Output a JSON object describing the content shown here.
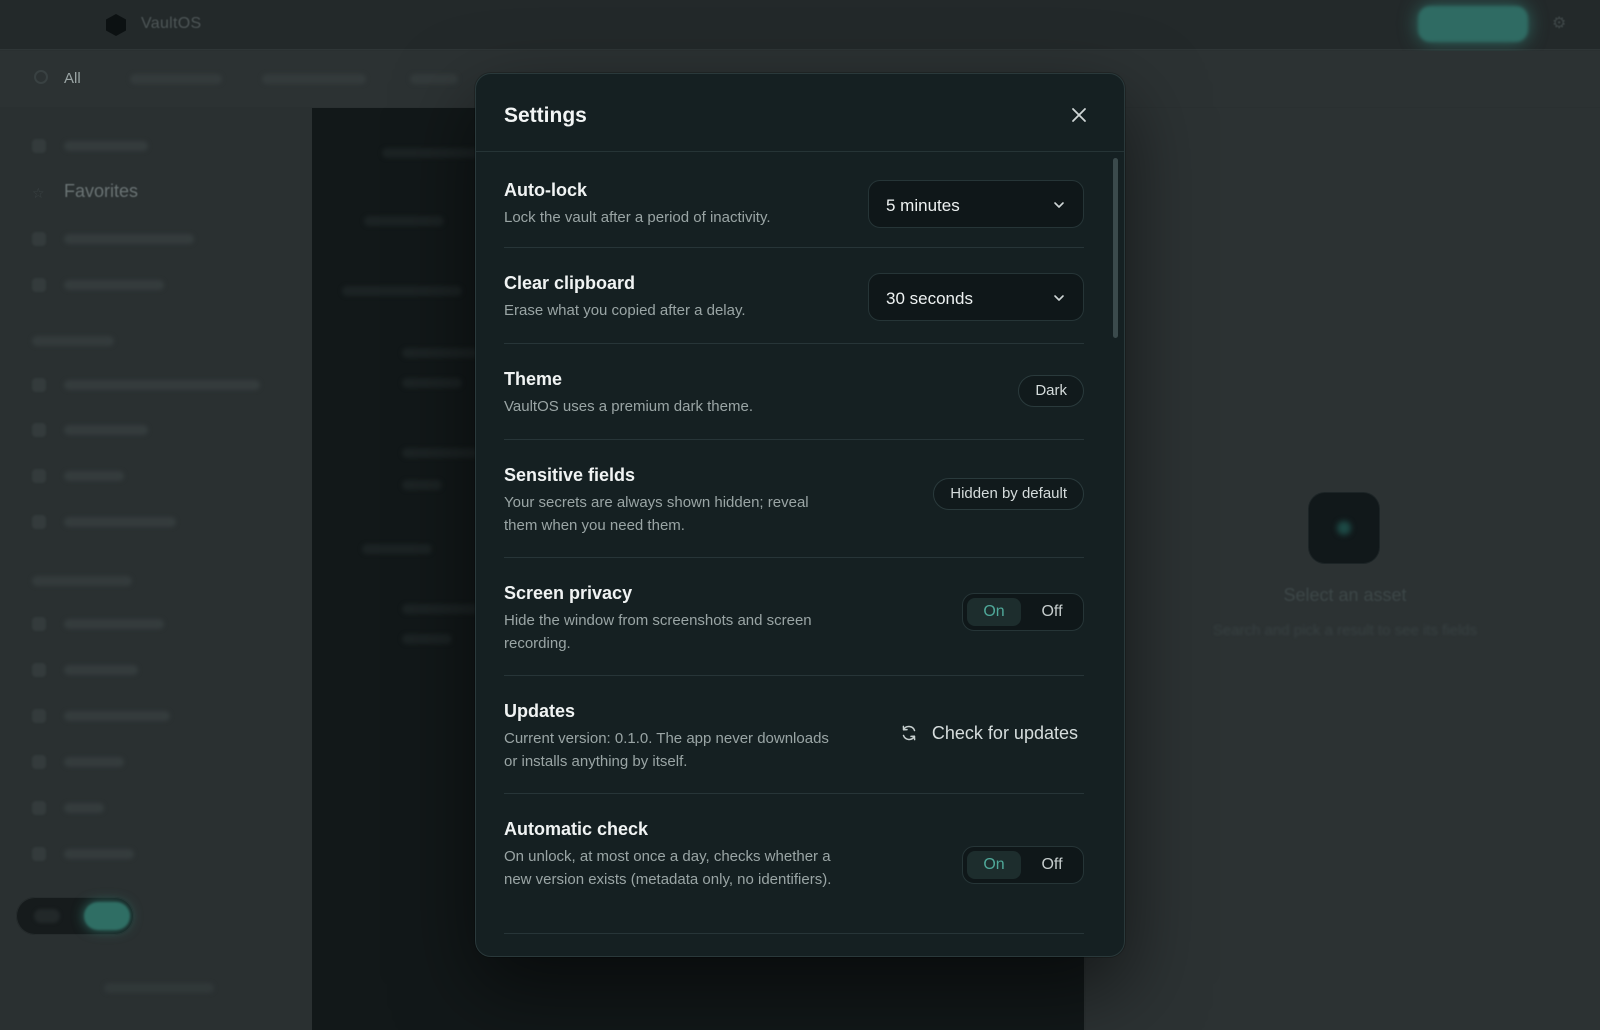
{
  "app": {
    "name": "VaultOS"
  },
  "filter": {
    "all_label": "All"
  },
  "sidebar": {
    "favorites_label": "Favorites"
  },
  "detail": {
    "title": "Select an asset",
    "subtitle": "Search and pick a result to see its fields"
  },
  "settings": {
    "title": "Settings",
    "rows": [
      {
        "title": "Auto-lock",
        "desc": "Lock the vault after a period of inactivity.",
        "control": "select",
        "value": "5 minutes"
      },
      {
        "title": "Clear clipboard",
        "desc": "Erase what you copied after a delay.",
        "control": "select",
        "value": "30 seconds"
      },
      {
        "title": "Theme",
        "desc": "VaultOS uses a premium dark theme.",
        "control": "badge",
        "value": "Dark"
      },
      {
        "title": "Sensitive fields",
        "desc": "Your secrets are always shown hidden; reveal them when you need them.",
        "control": "badge",
        "value": "Hidden by default"
      },
      {
        "title": "Screen privacy",
        "desc": "Hide the window from screenshots and screen recording.",
        "control": "toggle",
        "on_label": "On",
        "off_label": "Off",
        "selected": "On"
      },
      {
        "title": "Updates",
        "desc": "Current version: 0.1.0. The app never downloads or installs anything by itself.",
        "control": "button",
        "value": "Check for updates"
      },
      {
        "title": "Automatic check",
        "desc": "On unlock, at most once a day, checks whether a new version exists (metadata only, no identifiers).",
        "control": "toggle",
        "on_label": "On",
        "off_label": "Off",
        "selected": "On"
      }
    ]
  },
  "colors": {
    "accent": "#4fa899",
    "modal_bg": "#152022",
    "page_bg": "#2a3031"
  },
  "icons": {
    "close": "close-icon",
    "chevron": "chevron-down-icon",
    "refresh": "refresh-icon",
    "logo": "vault-logo-icon"
  }
}
